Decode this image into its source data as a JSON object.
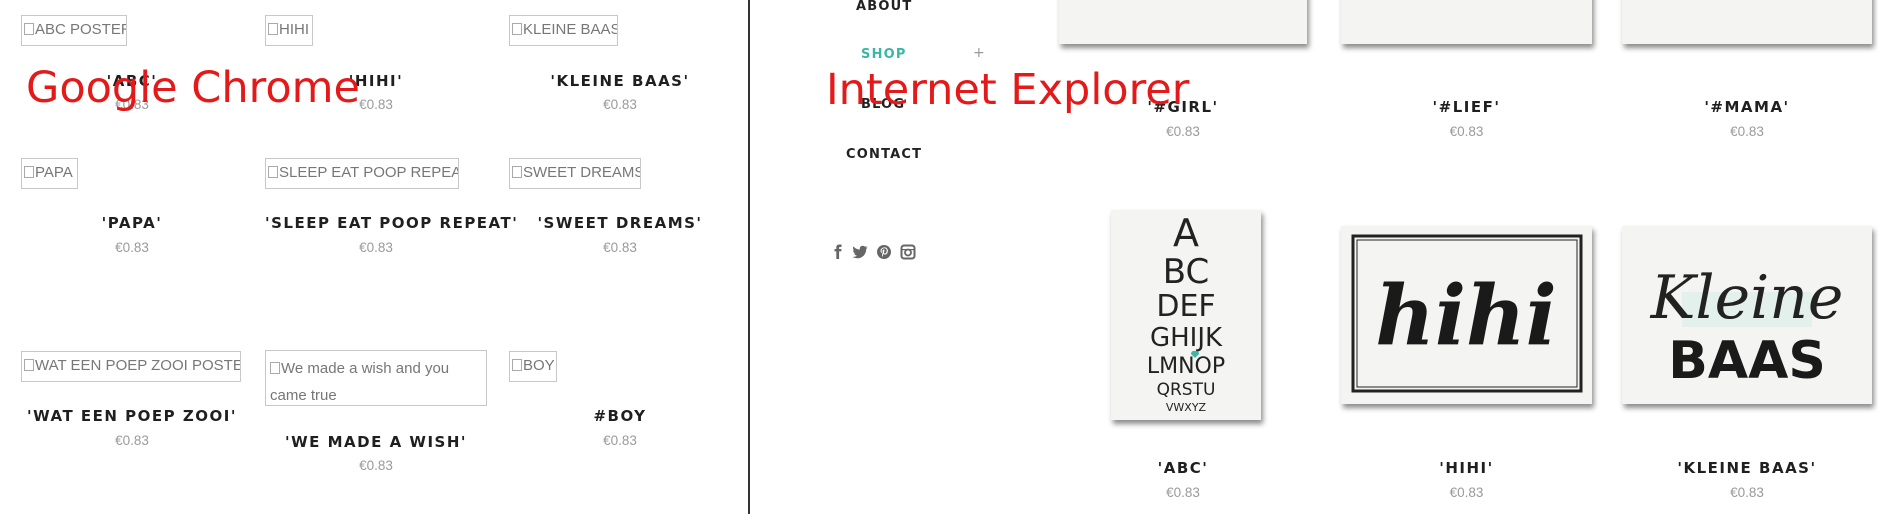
{
  "labels": {
    "chrome": "Google Chrome",
    "ie": "Internet Explorer"
  },
  "colors": {
    "overlay": "#e41a1a",
    "nav_active": "#3bb7a4",
    "divider": "#333333"
  },
  "chrome": {
    "products": [
      {
        "alt": "ABC POSTER",
        "title": "'ABC'",
        "price": "€0.83"
      },
      {
        "alt": "HIHI",
        "title": "'HIHI'",
        "price": "€0.83"
      },
      {
        "alt": "KLEINE BAAS",
        "title": "'KLEINE BAAS'",
        "price": "€0.83"
      },
      {
        "alt": "PAPA",
        "title": "'PAPA'",
        "price": "€0.83"
      },
      {
        "alt": "SLEEP EAT POOP REPEAT",
        "title": "'SLEEP EAT POOP REPEAT'",
        "price": "€0.83"
      },
      {
        "alt": "SWEET DREAMS",
        "title": "'SWEET DREAMS'",
        "price": "€0.83"
      },
      {
        "alt": "WAT EEN POEP ZOOI POSTER",
        "title": "'WAT EEN POEP ZOOI'",
        "price": "€0.83"
      },
      {
        "alt": "We made a wish and you came true",
        "title": "'WE MADE A WISH'",
        "price": "€0.83"
      },
      {
        "alt": "BOY",
        "title": "#BOY",
        "price": "€0.83"
      }
    ]
  },
  "ie": {
    "nav": {
      "about": "ABOUT",
      "shop": "SHOP",
      "shop_expand": "+",
      "blog": "BLOG",
      "contact": "CONTACT"
    },
    "social": [
      "facebook-icon",
      "twitter-icon",
      "pinterest-icon",
      "instagram-icon"
    ],
    "top_row": [
      {
        "title": "'#GIRL'",
        "price": "€0.83"
      },
      {
        "title": "'#LIEF'",
        "price": "€0.83"
      },
      {
        "title": "'#MAMA'",
        "price": "€0.83"
      }
    ],
    "bottom_row": [
      {
        "title": "'ABC'",
        "price": "€0.83"
      },
      {
        "title": "'HIHI'",
        "price": "€0.83"
      },
      {
        "title": "'KLEINE BAAS'",
        "price": "€0.83"
      }
    ],
    "poster_text": {
      "abc_lines": [
        "A",
        "BC",
        "DEF",
        "GHIJK",
        "LMNOP",
        "QRSTU",
        "VWXYZ"
      ],
      "hihi": "hihi",
      "kleine": "Kleine",
      "baas": "BAAS"
    }
  }
}
